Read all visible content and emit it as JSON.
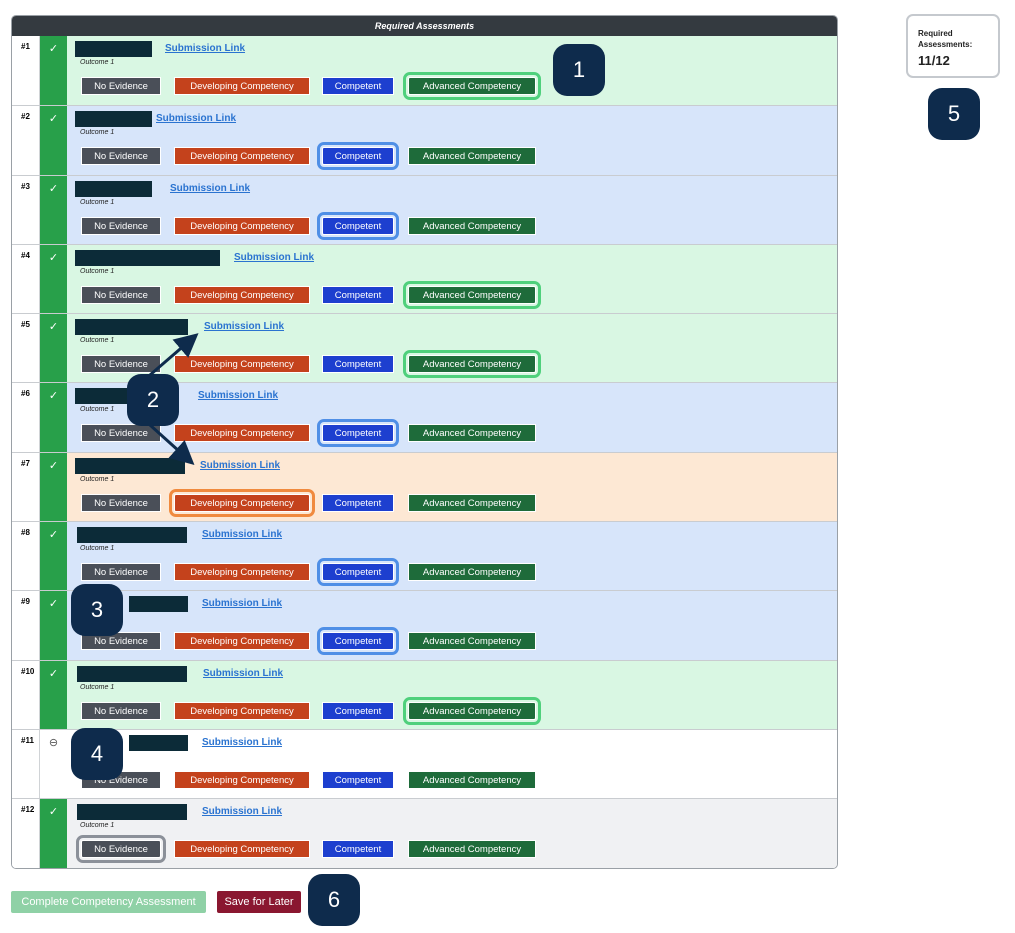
{
  "panel": {
    "header": "Required Assessments"
  },
  "buttons": {
    "no_evidence": "No Evidence",
    "developing": "Developing Competency",
    "competent": "Competent",
    "advanced": "Advanced Competency"
  },
  "rows": [
    {
      "num": "#1",
      "status": "check",
      "status_icon": "check-icon",
      "link": "Submission Link",
      "outcome": "Outcome 1",
      "selected": "advanced",
      "bg": "green"
    },
    {
      "num": "#2",
      "status": "check",
      "status_icon": "check-icon",
      "link": "Submission Link",
      "outcome": "Outcome 1",
      "selected": "competent",
      "bg": "blue"
    },
    {
      "num": "#3",
      "status": "check",
      "status_icon": "check-icon",
      "link": "Submission Link",
      "outcome": "Outcome 1",
      "selected": "competent",
      "bg": "blue"
    },
    {
      "num": "#4",
      "status": "check",
      "status_icon": "check-icon",
      "link": "Submission Link",
      "outcome": "Outcome 1",
      "selected": "advanced",
      "bg": "green"
    },
    {
      "num": "#5",
      "status": "check",
      "status_icon": "check-icon",
      "link": "Submission Link",
      "outcome": "Outcome 1",
      "selected": "advanced",
      "bg": "green"
    },
    {
      "num": "#6",
      "status": "check",
      "status_icon": "check-icon",
      "link": "Submission Link",
      "outcome": "Outcome 1",
      "selected": "competent",
      "bg": "blue"
    },
    {
      "num": "#7",
      "status": "check",
      "status_icon": "check-icon",
      "link": "Submission Link",
      "outcome": "Outcome 1",
      "selected": "developing",
      "bg": "orange"
    },
    {
      "num": "#8",
      "status": "check",
      "status_icon": "check-icon",
      "link": "Submission Link",
      "outcome": "Outcome 1",
      "selected": "competent",
      "bg": "blue"
    },
    {
      "num": "#9",
      "status": "check",
      "status_icon": "check-icon",
      "link": "Submission Link",
      "outcome": "",
      "selected": "competent",
      "bg": "blue"
    },
    {
      "num": "#10",
      "status": "check",
      "status_icon": "check-icon",
      "link": "Submission Link",
      "outcome": "Outcome 1",
      "selected": "advanced",
      "bg": "green"
    },
    {
      "num": "#11",
      "status": "none",
      "status_icon": "minus-circle-icon",
      "link": "Submission Link",
      "outcome": "",
      "selected": "",
      "bg": "white"
    },
    {
      "num": "#12",
      "status": "check",
      "status_icon": "check-icon",
      "link": "Submission Link",
      "outcome": "Outcome 1",
      "selected": "no_evidence",
      "bg": "gray"
    }
  ],
  "counter": {
    "label": "Required Assessments:",
    "value": "11/12"
  },
  "footer": {
    "complete": "Complete Competency Assessment",
    "save": "Save for Later"
  },
  "badges": [
    "1",
    "2",
    "3",
    "4",
    "5",
    "6"
  ]
}
